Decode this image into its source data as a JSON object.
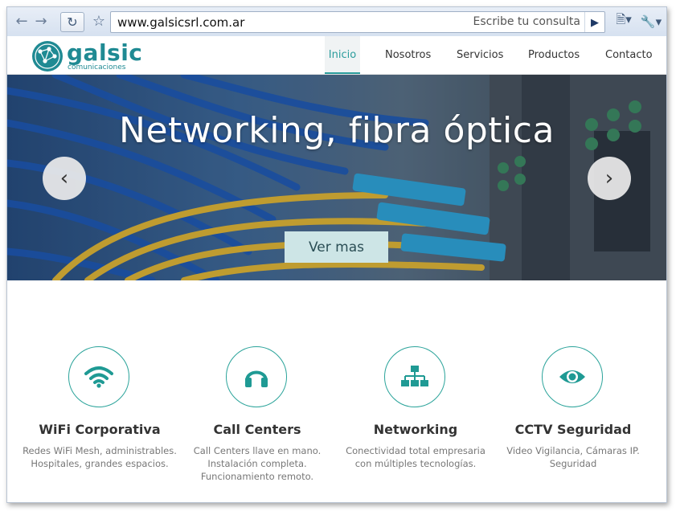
{
  "browser": {
    "url": "www.galsicsrl.com.ar",
    "search_placeholder": "Escribe tu consulta",
    "icons": [
      "back-arrow-icon",
      "forward-arrow-icon",
      "reload-icon",
      "bookmark-star-icon",
      "go-icon",
      "page-menu-icon",
      "wrench-icon"
    ]
  },
  "site": {
    "logo": {
      "name": "galsic",
      "tagline": "comunicaciones"
    },
    "nav": [
      {
        "label": "Inicio",
        "active": true
      },
      {
        "label": "Nosotros",
        "active": false
      },
      {
        "label": "Servicios",
        "active": false
      },
      {
        "label": "Productos",
        "active": false
      },
      {
        "label": "Contacto",
        "active": false
      }
    ]
  },
  "hero": {
    "title": "Networking, fibra óptica",
    "cta_label": "Ver mas",
    "prev_glyph": "‹",
    "next_glyph": "›"
  },
  "features": [
    {
      "icon": "wifi-icon",
      "title": "WiFi Corporativa",
      "desc_lines": [
        "Redes WiFi Mesh, administrables.",
        "Hospitales, grandes espacios."
      ]
    },
    {
      "icon": "headphones-icon",
      "title": "Call Centers",
      "desc_lines": [
        "Call Centers llave en mano.",
        "Instalación completa.",
        "Funcionamiento remoto."
      ]
    },
    {
      "icon": "network-icon",
      "title": "Networking",
      "desc_lines": [
        "Conectividad total empresaria",
        "con múltiples tecnologías."
      ]
    },
    {
      "icon": "eye-icon",
      "title": "CCTV Seguridad",
      "desc_lines": [
        "Video Vigilancia, Cámaras IP.",
        "Seguridad"
      ]
    }
  ],
  "colors": {
    "accent": "#2aa39a",
    "brand": "#1f8a93",
    "cta_bg": "#cde5e6"
  }
}
